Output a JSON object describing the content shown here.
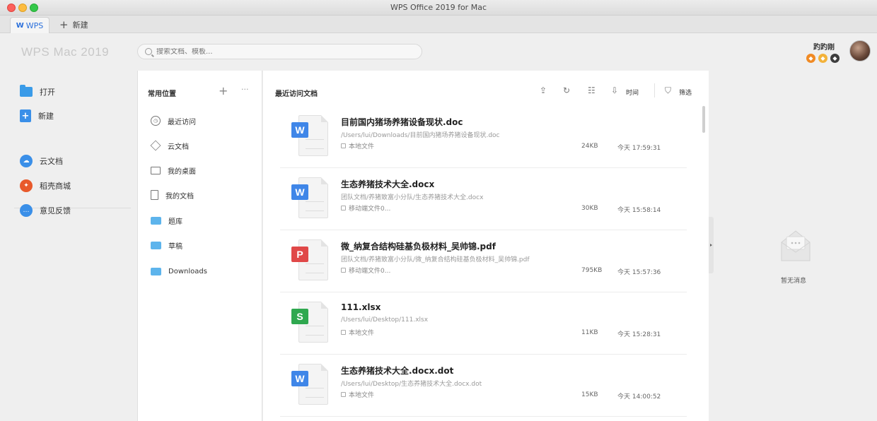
{
  "window": {
    "title": "WPS Office 2019 for Mac"
  },
  "tabs": {
    "wps_label": "WPS",
    "new_label": "新建"
  },
  "header": {
    "brand": "WPS Mac 2019",
    "search_placeholder": "搜索文档、模板...",
    "username": "趵趵刚"
  },
  "sidebar": {
    "items": [
      {
        "label": "打开",
        "icon": "folder-icon"
      },
      {
        "label": "新建",
        "icon": "new-document-icon"
      },
      {
        "label": "云文档",
        "icon": "cloud-docs-icon",
        "color": "#3a8fe8"
      },
      {
        "label": "稻壳商城",
        "icon": "docer-store-icon",
        "color": "#e8592b"
      },
      {
        "label": "意见反馈",
        "icon": "feedback-icon",
        "color": "#3a8fe8"
      }
    ]
  },
  "places": {
    "title": "常用位置",
    "add": "+",
    "more": "···",
    "items": [
      {
        "label": "最近访问",
        "icon": "clock-icon"
      },
      {
        "label": "云文档",
        "icon": "cube-icon"
      },
      {
        "label": "我的桌面",
        "icon": "desktop-icon"
      },
      {
        "label": "我的文档",
        "icon": "document-icon"
      },
      {
        "label": "题库",
        "icon": "folder-icon"
      },
      {
        "label": "草稿",
        "icon": "folder-icon"
      },
      {
        "label": "Downloads",
        "icon": "folder-icon"
      }
    ]
  },
  "files": {
    "title": "最近访问文档",
    "sort_label": "时间",
    "filter_label": "筛选",
    "rows": [
      {
        "name": "目前国内猪场养猪设备现状.doc",
        "path": "/Users/lui/Downloads/目前国内猪场养猪设备现状.doc",
        "location": "本地文件",
        "size": "24KB",
        "time": "今天 17:59:31",
        "type": "writer",
        "tag": "W",
        "color": "#3f86e8"
      },
      {
        "name": "生态养猪技术大全.docx",
        "path": "团队文档/养猪致富小分队/生态养猪技术大全.docx",
        "location": "移动端文件0...",
        "size": "30KB",
        "time": "今天 15:58:14",
        "type": "writer",
        "tag": "W",
        "color": "#3f86e8"
      },
      {
        "name": "微_纳复合结构硅基负极材料_吴帅锦.pdf",
        "path": "团队文档/养猪致富小分队/微_纳复合结构硅基负极材料_吴帅锦.pdf",
        "location": "移动端文件0...",
        "size": "795KB",
        "time": "今天 15:57:36",
        "type": "pdf",
        "tag": "P",
        "color": "#e04848"
      },
      {
        "name": "111.xlsx",
        "path": "/Users/lui/Desktop/111.xlsx",
        "location": "本地文件",
        "size": "11KB",
        "time": "今天 15:28:31",
        "type": "sheet",
        "tag": "S",
        "color": "#2fa84f"
      },
      {
        "name": "生态养猪技术大全.docx.dot",
        "path": "/Users/lui/Desktop/生态养猪技术大全.docx.dot",
        "location": "本地文件",
        "size": "15KB",
        "time": "今天 14:00:52",
        "type": "writer",
        "tag": "W",
        "color": "#3f86e8"
      }
    ]
  },
  "messages": {
    "empty_text": "暂无消息"
  }
}
